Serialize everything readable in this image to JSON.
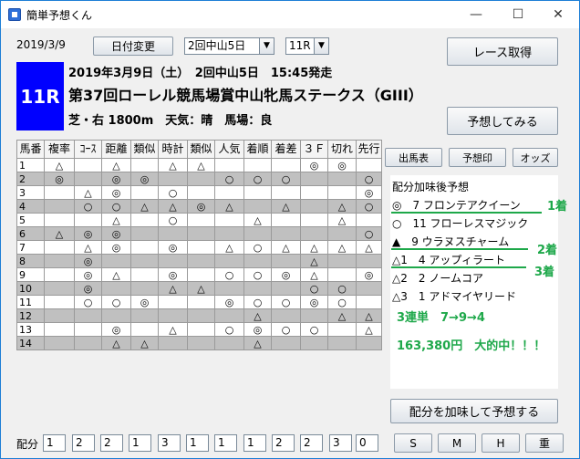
{
  "window": {
    "title": "簡単予想くん",
    "minimize": "—",
    "maximize": "☐",
    "close": "✕"
  },
  "top": {
    "date": "2019/3/9",
    "change_date_label": "日付変更",
    "meeting_select": "2回中山5日",
    "race_select": "11R",
    "fetch_button": "レース取得",
    "predict_button": "予想してみる"
  },
  "race": {
    "number": "11R",
    "info_line": "2019年3月9日（土）　2回中山5日　15:45発走",
    "name": "第37回ローレル競馬場賞中山牝馬ステークス（GIII）",
    "conditions": "芝・右 1800m　天気：晴　馬場：良"
  },
  "tabs": {
    "entries": "出馬表",
    "marks": "予想印",
    "odds": "オッズ"
  },
  "table": {
    "headers": [
      "馬番",
      "複率",
      "ｺｰｽ",
      "距離",
      "類似",
      "時計",
      "類似",
      "人気",
      "着順",
      "着差",
      "３Ｆ",
      "切れ",
      "先行"
    ],
    "rows": [
      [
        "1",
        "",
        "△",
        "",
        "△",
        "",
        "△",
        "△",
        "",
        "",
        "",
        "◎",
        "◎",
        ""
      ],
      [
        "2",
        "",
        "◎",
        "",
        "◎",
        "◎",
        "",
        "",
        "○",
        "○",
        "○",
        "",
        "",
        "○"
      ],
      [
        "3",
        "",
        "",
        "△",
        "◎",
        "",
        "○",
        "",
        "",
        "",
        "",
        "",
        "",
        "◎"
      ],
      [
        "4",
        "△",
        "",
        "○",
        "○",
        "△",
        "△",
        "◎",
        "△",
        "",
        "△",
        "",
        "△",
        "○"
      ],
      [
        "5",
        "",
        "",
        "",
        "△",
        "",
        "○",
        "",
        "",
        "△",
        "",
        "",
        "△",
        ""
      ],
      [
        "6",
        "",
        "△",
        "◎",
        "◎",
        "",
        "",
        "",
        "",
        "",
        "",
        "",
        "",
        "○"
      ],
      [
        "7",
        "△",
        "",
        "△",
        "◎",
        "",
        "◎",
        "",
        "△",
        "○",
        "△",
        "△",
        "△",
        "△"
      ],
      [
        "8",
        "",
        "",
        "◎",
        "",
        "",
        "",
        "",
        "",
        "",
        "",
        "△",
        "",
        ""
      ],
      [
        "9",
        "△",
        "",
        "◎",
        "△",
        "",
        "◎",
        "",
        "○",
        "○",
        "◎",
        "△",
        "",
        "◎"
      ],
      [
        "10",
        "",
        "",
        "◎",
        "",
        "",
        "△",
        "△",
        "",
        "",
        "",
        "○",
        "○",
        ""
      ],
      [
        "11",
        "○",
        "",
        "○",
        "○",
        "◎",
        "",
        "",
        "◎",
        "○",
        "○",
        "◎",
        "○",
        ""
      ],
      [
        "12",
        "",
        "",
        "",
        "",
        "",
        "",
        "",
        "",
        "△",
        "",
        "",
        "△",
        "△"
      ],
      [
        "13",
        "◎",
        "",
        "",
        "◎",
        "",
        "△",
        "",
        "○",
        "◎",
        "○",
        "○",
        "",
        "△"
      ],
      [
        "14",
        "△",
        "",
        "",
        "△",
        "△",
        "",
        "",
        "",
        "△",
        "",
        "",
        "",
        ""
      ]
    ]
  },
  "prediction": {
    "heading": "配分加味後予想",
    "lines": [
      "◎　7 フロンテアクイーン",
      "○　11 フローレスマジック",
      "▲　9 ウラヌスチャーム",
      "△1　4 アップィラート",
      "△2　2 ノームコア",
      "△3　1 アドマイヤリード"
    ],
    "place1": "1着",
    "place2": "2着",
    "place3": "3着",
    "bet_result": "3連単　7→9→4",
    "payout": "163,380円　大的中！！！"
  },
  "bottom": {
    "weights_label": "配分",
    "weights": [
      "1",
      "2",
      "2",
      "1",
      "3",
      "1",
      "1",
      "1",
      "2",
      "2",
      "3",
      "0"
    ],
    "apply_button": "配分を加味して予想する",
    "presets": [
      "S",
      "M",
      "H",
      "重"
    ]
  },
  "colors": {
    "race_number_bg": "#0000ff",
    "highlight_green": "#1ea84a",
    "row_shade": "#c0c0c0"
  }
}
